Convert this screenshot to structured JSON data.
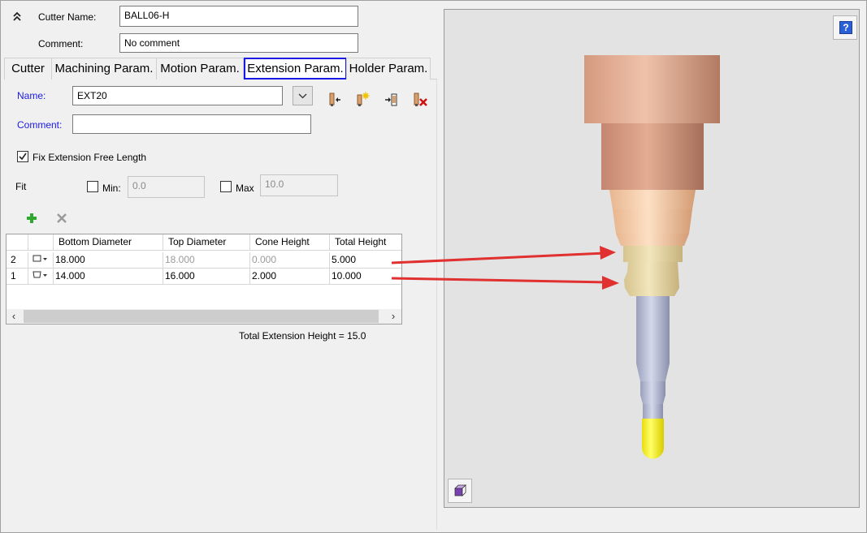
{
  "header": {
    "collapse_icon": "double-chevron-up-icon",
    "cutter_name_label": "Cutter Name:",
    "cutter_name_value": "BALL06-H",
    "comment_label": "Comment:",
    "comment_value": "No comment"
  },
  "tabs": [
    {
      "label": "Cutter"
    },
    {
      "label": "Machining Param."
    },
    {
      "label": "Motion Param."
    },
    {
      "label": "Extension Param.",
      "active": true
    },
    {
      "label": "Holder Param."
    }
  ],
  "extension": {
    "name_label": "Name:",
    "name_value": "EXT20",
    "comment_label": "Comment:",
    "comment_value": "",
    "toolbar_icons": [
      "load-extension-icon",
      "new-extension-icon",
      "save-extension-icon",
      "delete-extension-icon"
    ],
    "fix_free_length_label": "Fix Extension Free Length",
    "fix_free_length_checked": true,
    "fit_label": "Fit",
    "min_label": "Min:",
    "min_checked": false,
    "min_value": "0.0",
    "max_label": "Max",
    "max_checked": false,
    "max_value": "10.0",
    "add_row_icon": "plus-icon",
    "remove_row_icon": "cross-icon"
  },
  "table": {
    "columns": [
      "Bottom Diameter",
      "Top Diameter",
      "Cone Height",
      "Total Height"
    ],
    "rows": [
      {
        "index": "2",
        "bottom_diameter": "18.000",
        "top_diameter": "18.000",
        "cone_height": "0.000",
        "total_height": "5.000"
      },
      {
        "index": "1",
        "bottom_diameter": "14.000",
        "top_diameter": "16.000",
        "cone_height": "2.000",
        "total_height": "10.000"
      }
    ],
    "total_label": "Total Extension Height = 15.0"
  },
  "viewer": {
    "help_label": "?",
    "help_icon": "help-icon",
    "view_icon": "view-cube-icon",
    "colors": {
      "holder_top": "#d9a88f",
      "holder_mid": "#c48c72",
      "adapter": "#f2c9a4",
      "extension": "#e6d8a8",
      "shank": "#b9bfd6",
      "ball": "#f5ec1a",
      "arrow": "#e03030"
    }
  }
}
